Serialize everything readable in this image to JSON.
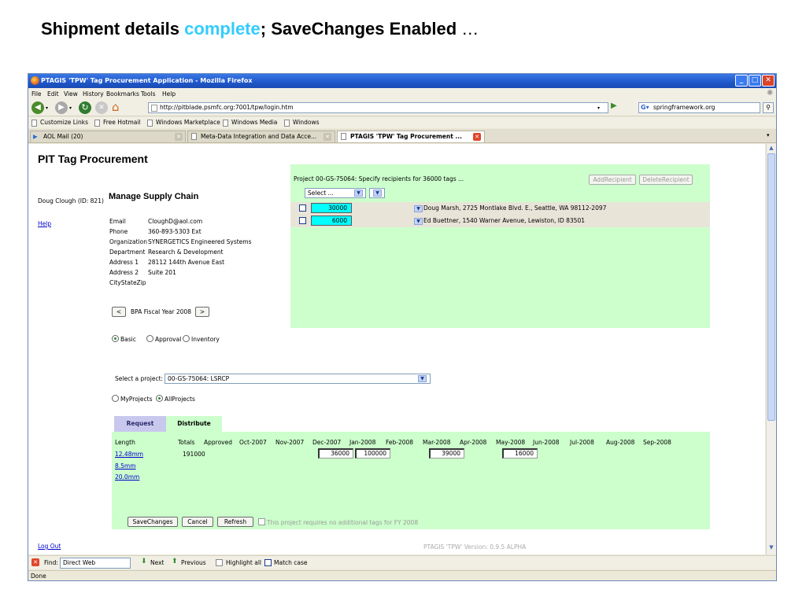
{
  "slide_title": {
    "part1": "Shipment details ",
    "highlight": "complete",
    "part2": "; SaveChanges Enabled",
    "ellipsis": " …"
  },
  "window": {
    "title": "PTAGIS 'TPW' Tag Procurement Application - Mozilla Firefox"
  },
  "menu": [
    "File",
    "Edit",
    "View",
    "History",
    "Bookmarks",
    "Tools",
    "Help"
  ],
  "nav": {
    "url": "http://pitblade.psmfc.org:7001/tpw/login.htm",
    "search": "springframework.org"
  },
  "bookmarks": [
    "Customize Links",
    "Free Hotmail",
    "Windows Marketplace",
    "Windows Media",
    "Windows"
  ],
  "tabs": [
    "AOL Mail (20)",
    "Meta-Data Integration and Data Acce...",
    "PTAGIS 'TPW' Tag Procurement ..."
  ],
  "page": {
    "app_title": "PIT Tag Procurement",
    "user": "Doug Clough (ID: 821)",
    "help": "Help",
    "logout": "Log Out",
    "section_title": "Manage Supply Chain",
    "contact": [
      {
        "label": "Email",
        "value": "CloughD@aol.com"
      },
      {
        "label": "Phone",
        "value": "360-893-5303 Ext"
      },
      {
        "label": "Organization",
        "value": "SYNERGETICS Engineered Systems"
      },
      {
        "label": "Department",
        "value": "Research & Development"
      },
      {
        "label": "Address 1",
        "value": "28112 144th Avenue East"
      },
      {
        "label": "Address 2",
        "value": "Suite 201"
      },
      {
        "label": "CityStateZip",
        "value": ""
      }
    ],
    "fiscal_prev": "<",
    "fiscal_label": "BPA Fiscal Year 2008",
    "fiscal_next": ">",
    "modes": [
      "Basic",
      "Approval",
      "Inventory"
    ],
    "project_select_label": "Select a project:",
    "project_selected": "00-GS-75064: LSRCP",
    "project_scope": [
      "MyProjects",
      "AllProjects"
    ],
    "tabs": [
      "Request",
      "Distribute"
    ],
    "grid": {
      "headers": [
        "Length",
        "Totals",
        "Approved",
        "Oct-2007",
        "Nov-2007",
        "Dec-2007",
        "Jan-2008",
        "Feb-2008",
        "Mar-2008",
        "Apr-2008",
        "May-2008",
        "Jun-2008",
        "Jul-2008",
        "Aug-2008",
        "Sep-2008"
      ],
      "lengths": [
        "12.48mm",
        "8.5mm",
        "20.0mm"
      ],
      "total": "191000",
      "dec": "36000",
      "jan": "100000",
      "mar": "39000",
      "may": "16000"
    },
    "buttons": {
      "save": "SaveChanges",
      "cancel": "Cancel",
      "refresh": "Refresh"
    },
    "no_tags_note": "This project requires no additional tags for FY 2008",
    "version": "PTAGIS 'TPW' Version: 0.9.5 ALPHA"
  },
  "recipients": {
    "header": "Project 00-GS-75064: Specify recipients for 36000 tags ...",
    "add": "AddRecipient",
    "delete": "DeleteRecipient",
    "select": "Select ...",
    "rows": [
      {
        "qty": "30000",
        "name": "Doug Marsh, 2725 Montlake Blvd. E., Seattle, WA 98112-2097"
      },
      {
        "qty": "6000",
        "name": "Ed Buettner, 1540 Warner Avenue, Lewiston, ID 83501"
      }
    ]
  },
  "findbar": {
    "label": "Find:",
    "value": "Direct Web",
    "next": "Next",
    "previous": "Previous",
    "highlight": "Highlight all",
    "match": "Match case"
  },
  "status": "Done",
  "colors": {
    "accent": "#33ccff",
    "panel_green": "#ccffcc",
    "qty_cyan": "#00ffff",
    "titlebar": "#1f57c9"
  }
}
